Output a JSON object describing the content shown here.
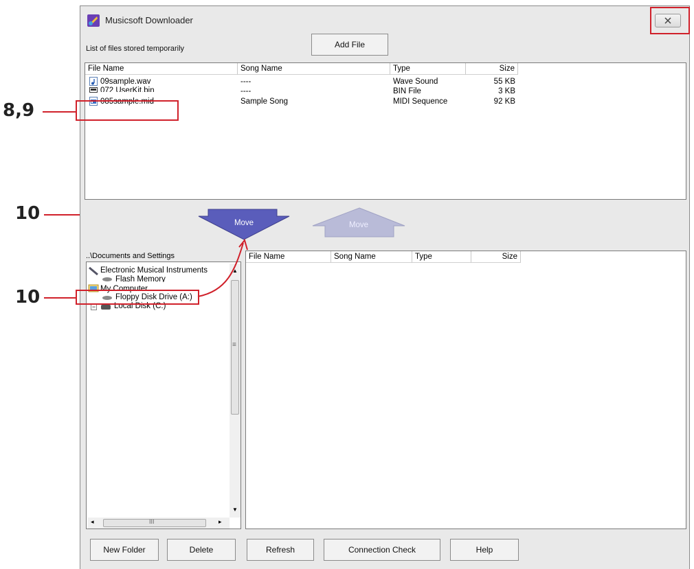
{
  "callouts": {
    "c1": "8,9",
    "c2": "10",
    "c3": "10"
  },
  "window": {
    "title": "Musicsoft Downloader"
  },
  "top": {
    "label": "List of files stored temporarily",
    "add_file": "Add File",
    "columns": [
      "File Name",
      "Song Name",
      "Type",
      "Size"
    ],
    "rows": [
      {
        "file": "09sample.wav",
        "song": "----",
        "type": "Wave Sound",
        "size": "55 KB",
        "icon": "audio-file-icon"
      },
      {
        "file": "072 UserKit.bin",
        "song": "----",
        "type": "BIN File",
        "size": "3 KB",
        "icon": "bin-file-icon"
      },
      {
        "file": "085sample.mid",
        "song": "Sample Song",
        "type": "MIDI Sequence",
        "size": "92 KB",
        "icon": "midi-file-icon"
      }
    ]
  },
  "move": {
    "down": "Move",
    "up": "Move"
  },
  "bottom": {
    "path": "..\\Documents and Settings",
    "tree": [
      {
        "label": "Electronic Musical Instruments",
        "icon": "instrument-icon"
      },
      {
        "label": "Flash Memory",
        "icon": "drive-icon"
      },
      {
        "label": "My Computer",
        "icon": "computer-icon"
      },
      {
        "label": "Floppy Disk Drive (A:)",
        "icon": "floppy-icon"
      },
      {
        "label": "Local Disk (C:)",
        "icon": "disk-icon"
      }
    ],
    "columns": [
      "File Name",
      "Song Name",
      "Type",
      "Size"
    ],
    "hscroll_grip": "III",
    "vscroll_grip": "≡"
  },
  "buttons": {
    "new_folder": "New Folder",
    "delete": "Delete",
    "refresh": "Refresh",
    "connection_check": "Connection Check",
    "help": "Help"
  },
  "colors": {
    "callout_red": "#d0202a",
    "move_active": "#5a5dbb",
    "move_inactive": "#b9bbd8"
  }
}
